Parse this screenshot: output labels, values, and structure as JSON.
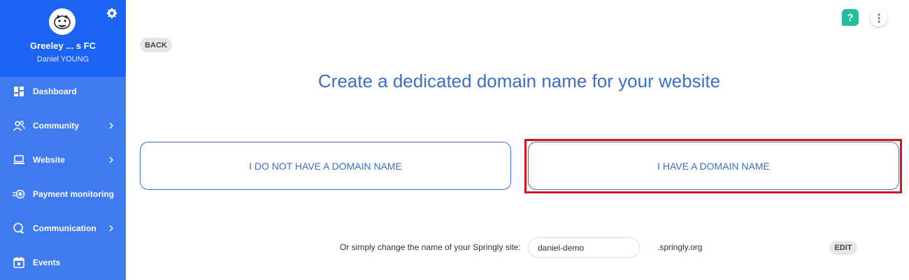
{
  "sidebar": {
    "club_name": "Greeley ... s FC",
    "user_name": "Daniel YOUNG",
    "items": [
      {
        "label": "Dashboard",
        "icon": "dashboard-icon",
        "has_submenu": false
      },
      {
        "label": "Community",
        "icon": "community-icon",
        "has_submenu": true
      },
      {
        "label": "Website",
        "icon": "laptop-icon",
        "has_submenu": true
      },
      {
        "label": "Payment monitoring",
        "icon": "payment-icon",
        "has_submenu": false
      },
      {
        "label": "Communication",
        "icon": "chat-icon",
        "has_submenu": true
      },
      {
        "label": "Events",
        "icon": "calendar-icon",
        "has_submenu": false
      }
    ]
  },
  "header": {
    "help_label": "?",
    "back_label": "BACK"
  },
  "main": {
    "title": "Create a dedicated domain name for your website",
    "option_no_domain": "I DO NOT HAVE A DOMAIN NAME",
    "option_have_domain": "I HAVE A DOMAIN NAME",
    "site_hint": "Or simply change the name of your Springly site:",
    "site_value": "daniel-demo",
    "site_suffix": ".springly.org",
    "edit_label": "EDIT"
  },
  "colors": {
    "sidebar_bg": "#3f7bf0",
    "sidebar_header_bg": "#1b63f5",
    "accent": "#3a6ec7",
    "help_green": "#1fbf99",
    "highlight_red": "#d0151d"
  }
}
